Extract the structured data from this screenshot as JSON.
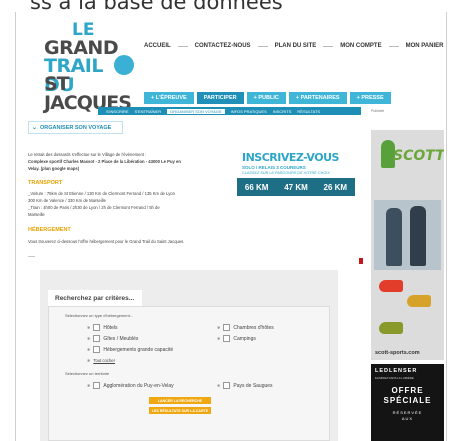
{
  "caption": "ss à la base de données",
  "logo": {
    "l1": "LE",
    "l2": "GRAND",
    "l3": "TRAIL DU",
    "l4": "ST JACQUES"
  },
  "topnav": [
    "Accueil",
    "Contactez-nous",
    "Plan du site",
    "Mon compte",
    "Mon panier"
  ],
  "mainnav": [
    {
      "label": "+ L'épreuve",
      "active": false
    },
    {
      "label": "Participer",
      "active": true
    },
    {
      "label": "+ Public",
      "active": false
    },
    {
      "label": "+ Partenaires",
      "active": false
    },
    {
      "label": "+ Presse",
      "active": false
    }
  ],
  "subnav": [
    {
      "label": "S'inscrire",
      "active": false
    },
    {
      "label": "S'entraîner",
      "active": false
    },
    {
      "label": "Organiser son voyage",
      "active": true
    },
    {
      "label": "Infos pratiques",
      "active": false
    },
    {
      "label": "Inscrits",
      "active": false
    },
    {
      "label": "Résultats",
      "active": false
    }
  ],
  "page": {
    "title": "Organiser son voyage",
    "intro_1": "Le retrait des dossards s'effectue sur le Village de l'événement :",
    "intro_2": "Complexe sportif Charles Massot - 2 Place de la Libération - 43000 Le Puy en",
    "intro_3": "Velay. (plan google maps)",
    "transport_title": "Transport",
    "transport_1": "_Voiture : 75km de St Etienne / 130 Km de Clermont Ferrand / 135 Km de Lyon",
    "transport_2": "300 Km de Valence / 330 Km de Marseille",
    "transport_3": "_Train : 4h00 de Paris / 2h30 de Lyon / 2h de Clermont Ferrand / 5h de",
    "transport_4": "Marseille",
    "hebergement_title": "Hébergement",
    "hebergement_1": "Vous trouverez ci-dessous l'offre hébergement pour le Grand Trail du Saint Jacques.",
    "dashes": "___"
  },
  "inscription": {
    "title": "INSCRIVEZ-VOUS",
    "subtitle": "SOLO / RELAIS 3 COUREURS",
    "note": "CLASSEZ SUR LE PARCOURS DE VOTRE CHOIX",
    "distances": [
      "66 KM",
      "47 KM",
      "26 KM"
    ]
  },
  "search": {
    "header": "Recherchez par critères...",
    "type_label": "Sélectionnez un type d'hébergement...",
    "options_left": [
      "Hôtels",
      "Gîtes / Meublés",
      "Hébergements grande capacité"
    ],
    "options_right": [
      "Chambres d'hôtes",
      "Campings"
    ],
    "select_all": "Tout cocher",
    "territory_label": "Sélectionnez un territoire",
    "territory_left": "Agglomération du Puy-en-Velay",
    "territory_right": "Pays de Saugues",
    "btn_search": "Lancer la recherche",
    "btn_map": "Les résultats sur la carte"
  },
  "sidebar": {
    "label": "Publicité",
    "scott_brand": "SCOTT",
    "scott_url": "scott-sports.com",
    "leden_brand": "LEDLENSER",
    "leden_tag": "Eliminez dans la lumière",
    "leden_offer_1": "OFFRE",
    "leden_offer_2": "SPÉCIALE",
    "leden_offer_3": "RÉSERVÉE",
    "leden_offer_4": "AUX"
  },
  "colors": {
    "accent": "#2da6c8",
    "nav_active": "#2090b8",
    "section": "#e8a200",
    "button": "#f0a812"
  }
}
